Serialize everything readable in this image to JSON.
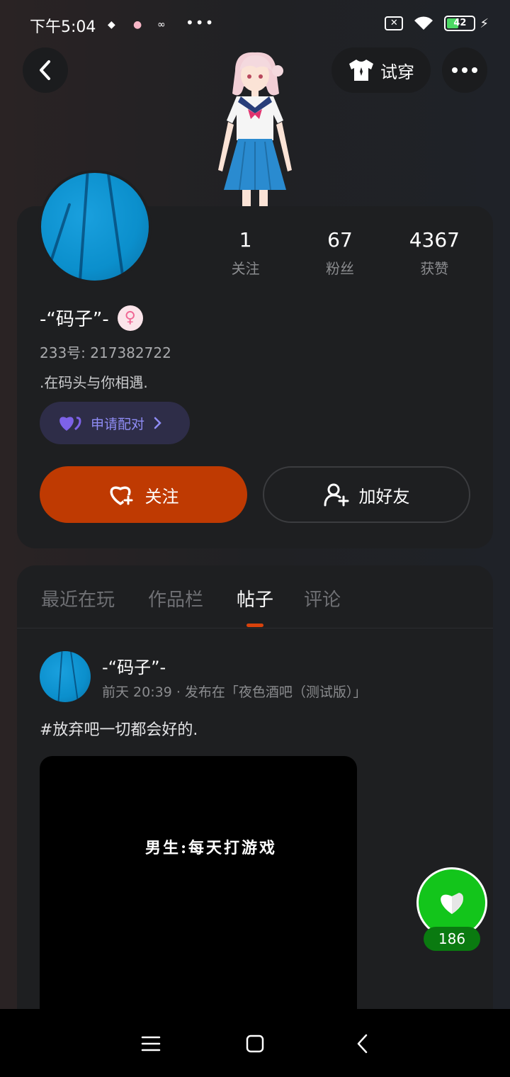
{
  "status_bar": {
    "time": "下午5:04",
    "dots": "•••",
    "battery": "42",
    "sim_icon": "sim-x-icon"
  },
  "header": {
    "back_icon": "chevron-left-icon",
    "try_on_label": "试穿",
    "more_icon": "more-dots-icon"
  },
  "profile": {
    "stats": [
      {
        "value": "1",
        "label": "关注"
      },
      {
        "value": "67",
        "label": "粉丝"
      },
      {
        "value": "4367",
        "label": "获赞"
      }
    ],
    "nickname": "-“码子”-",
    "gender_symbol": "♀",
    "uid": "233号: 217382722",
    "bio": ".在码头与你相遇.",
    "pair_label": "申请配对",
    "follow_label": "关注",
    "add_friend_label": "加好友"
  },
  "tabs": [
    {
      "label": "最近在玩"
    },
    {
      "label": "作品栏"
    },
    {
      "label": "帖子"
    },
    {
      "label": "评论"
    }
  ],
  "active_tab": "帖子",
  "post": {
    "author": "-“码子”-",
    "meta": "前天 20:39 · 发布在「夜色酒吧（测试版）」",
    "text": "#放弃吧一切都会好的.",
    "video_caption": "男生:每天打游戏"
  },
  "like": {
    "count": "186"
  },
  "colors": {
    "accent": "#bf3a02",
    "like_green": "#13c51b",
    "pair_purple": "#8f8cf5"
  }
}
